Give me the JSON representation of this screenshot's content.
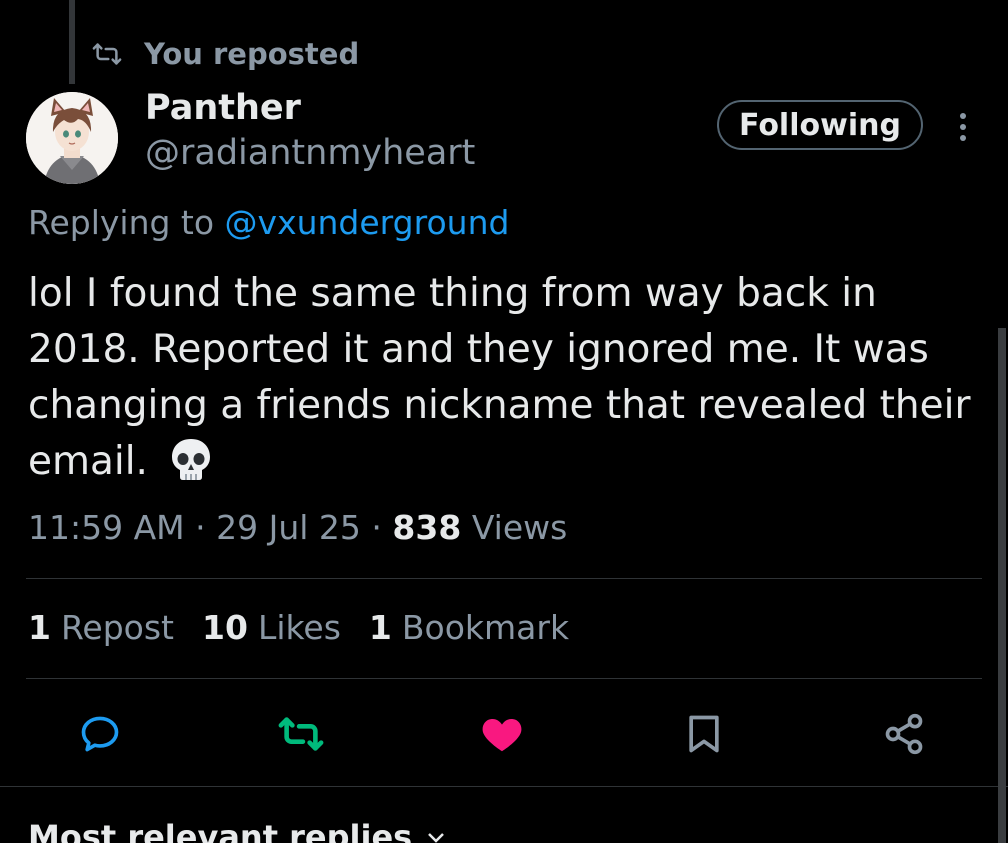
{
  "repost_banner": {
    "text": "You reposted",
    "icon": "repost-icon"
  },
  "author": {
    "display_name": "Panther",
    "handle": "@radiantnmyheart",
    "avatar": "anime-cat-ear-avatar"
  },
  "follow_button": {
    "label": "Following"
  },
  "more_menu": {
    "icon": "more-vertical-icon"
  },
  "reply_context": {
    "prefix": "Replying to",
    "mention": "@vxunderground"
  },
  "tweet": {
    "text": "lol I found the same thing from way back in 2018. Reported it and they ignored me. It was changing a friends nickname that revealed their email.",
    "emoji": "skull-emoji"
  },
  "meta": {
    "time": "11:59 AM",
    "separator": "·",
    "date": "29 Jul 25",
    "views_count": "838",
    "views_label": "Views"
  },
  "stats": [
    {
      "count": "1",
      "label": "Repost"
    },
    {
      "count": "10",
      "label": "Likes"
    },
    {
      "count": "1",
      "label": "Bookmark"
    }
  ],
  "actions": [
    {
      "name": "reply",
      "icon": "reply-icon"
    },
    {
      "name": "repost",
      "icon": "repost-icon",
      "active": true,
      "color": "#00ba7c"
    },
    {
      "name": "like",
      "icon": "heart-icon",
      "active": true,
      "color": "#f91880"
    },
    {
      "name": "bookmark",
      "icon": "bookmark-icon"
    },
    {
      "name": "share",
      "icon": "share-icon"
    }
  ],
  "replies_section": {
    "title": "Most relevant replies",
    "icon": "chevron-down-icon"
  },
  "colors": {
    "background": "#000000",
    "primary_text": "#e7e9ea",
    "secondary_text": "#8b98a5",
    "link": "#1d9bf0",
    "repost_green": "#00ba7c",
    "like_pink": "#f91880",
    "divider": "#2f3336"
  }
}
